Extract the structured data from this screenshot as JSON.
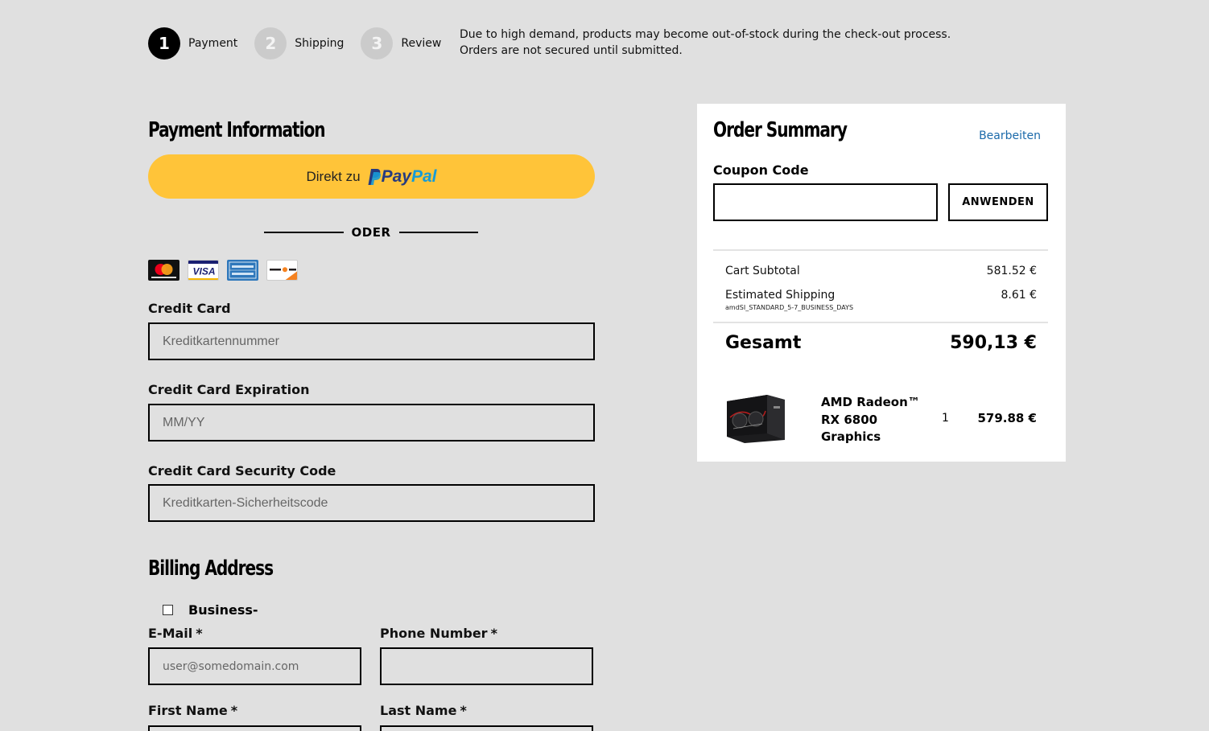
{
  "steps": [
    {
      "number": "1",
      "label": "Payment"
    },
    {
      "number": "2",
      "label": "Shipping"
    },
    {
      "number": "3",
      "label": "Review"
    }
  ],
  "notice": "Due to high demand, products may become out-of-stock during the check-out process. Orders are not secured until submitted.",
  "payment": {
    "title": "Payment Information",
    "paypal_prefix": "Direkt zu",
    "paypal_word_a": "Pay",
    "paypal_word_b": "Pal",
    "divider_text": "ODER",
    "card_icons": [
      "mastercard-icon",
      "visa-icon",
      "amex-icon",
      "discover-icon"
    ],
    "credit_card_label": "Credit Card",
    "credit_card_placeholder": "Kreditkartennummer",
    "expiration_label": "Credit Card Expiration",
    "expiration_placeholder": "MM/YY",
    "security_label": "Credit Card Security Code",
    "security_placeholder": "Kreditkarten-Sicherheitscode"
  },
  "billing": {
    "title": "Billing Address",
    "business_label": "Business-",
    "email_label": "E-Mail",
    "email_placeholder": "user@somedomain.com",
    "phone_label": "Phone Number",
    "first_name_label": "First Name",
    "last_name_label": "Last Name",
    "required_mark": "*"
  },
  "summary": {
    "title": "Order Summary",
    "edit_link": "Bearbeiten",
    "coupon_label": "Coupon Code",
    "coupon_value": "",
    "apply_button": "ANWENDEN",
    "subtotal_label": "Cart Subtotal",
    "subtotal_value": "581.52 €",
    "shipping_label": "Estimated Shipping",
    "shipping_value": "8.61 €",
    "shipping_code": "amdSI_STANDARD_5-7_BUSINESS_DAYS",
    "total_label": "Gesamt",
    "total_value": "590,13 €",
    "item": {
      "name": "AMD Radeon™ RX 6800 Graphics",
      "quantity": "1",
      "price": "579.88 €"
    }
  },
  "colors": {
    "background": "#e0e0e0",
    "paypal_yellow": "#ffc439",
    "link_blue": "#1b6aaa"
  }
}
